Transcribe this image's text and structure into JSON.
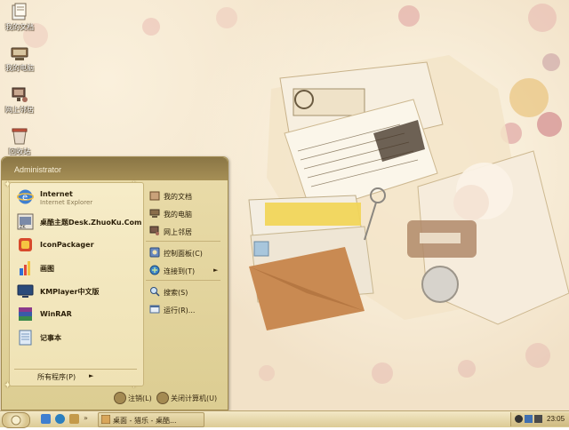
{
  "desktop": {
    "icons": [
      {
        "label": "我的文档",
        "icon": "folder-documents-icon"
      },
      {
        "label": "我的电脑",
        "icon": "computer-icon"
      },
      {
        "label": "网上邻居",
        "icon": "network-icon"
      },
      {
        "label": "回收站",
        "icon": "recycle-bin-icon"
      }
    ]
  },
  "start_menu": {
    "user": "Administrator",
    "programs": [
      {
        "name": "Internet",
        "desc": "Internet Explorer",
        "icon": "internet-explorer-icon"
      },
      {
        "name": "桌酷主题Desk.ZhuoKu.Com",
        "desc": "",
        "icon": "zhuoku-icon"
      },
      {
        "name": "IconPackager",
        "desc": "",
        "icon": "iconpackager-icon"
      },
      {
        "name": "画图",
        "desc": "",
        "icon": "paint-icon"
      },
      {
        "name": "KMPlayer中文版",
        "desc": "",
        "icon": "kmplayer-icon"
      },
      {
        "name": "WinRAR",
        "desc": "",
        "icon": "winrar-icon"
      },
      {
        "name": "记事本",
        "desc": "",
        "icon": "notepad-icon"
      }
    ],
    "all_programs": "所有程序(P)",
    "all_programs_arrow": "►",
    "right_items": [
      {
        "label": "我的文档",
        "icon": "documents-icon"
      },
      {
        "label": "我的电脑",
        "icon": "computer-icon"
      },
      {
        "label": "网上邻居",
        "icon": "network-icon"
      },
      {
        "label": "控制面板(C)",
        "icon": "control-panel-icon"
      },
      {
        "label": "连接到(T)",
        "icon": "connect-icon",
        "arrow": "►"
      },
      {
        "label": "搜索(S)",
        "icon": "search-icon"
      },
      {
        "label": "运行(R)...",
        "icon": "run-icon"
      }
    ],
    "logoff": "注销(L)",
    "shutdown": "关闭计算机(U)"
  },
  "taskbar": {
    "task_label": "桌面 - 猎乐 - 桌酷...",
    "clock": "23:05"
  },
  "colors": {
    "accent": "#a68f56",
    "menu_bg": "#eadcaa",
    "taskbar_bg": "#e8d9a8"
  }
}
